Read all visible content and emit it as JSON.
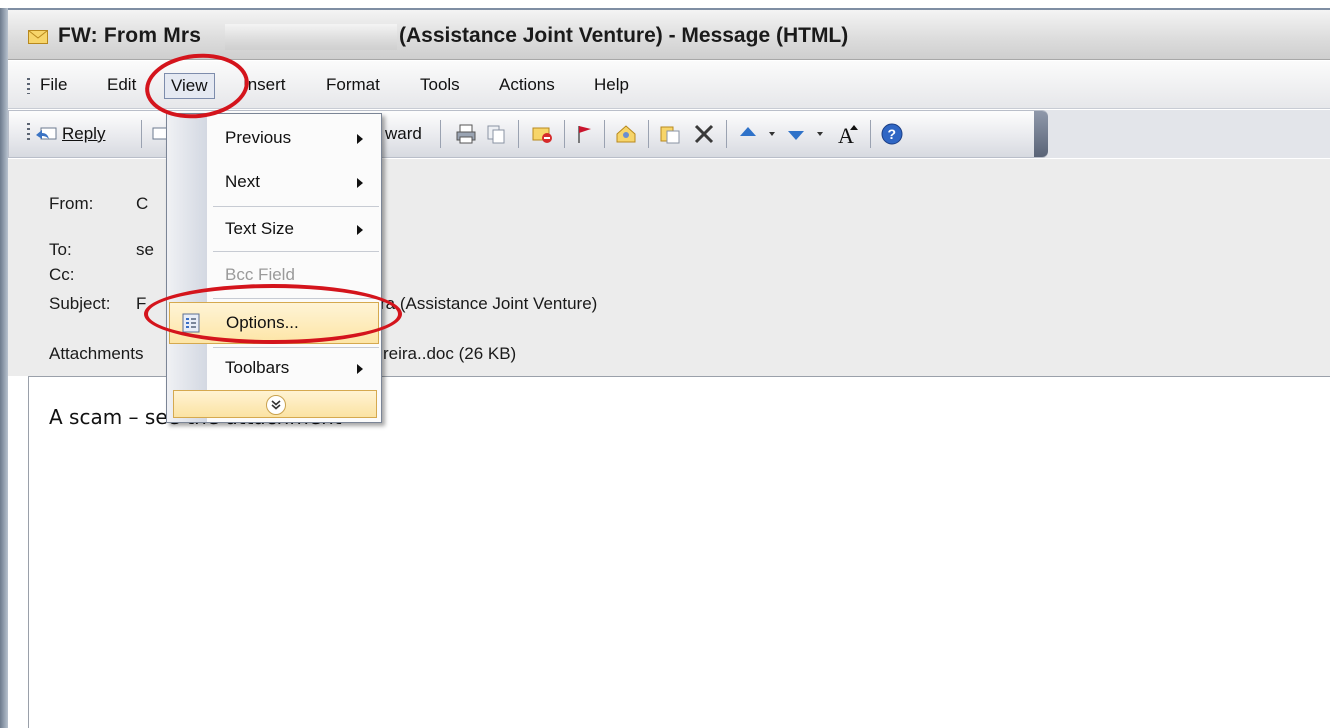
{
  "window": {
    "title_prefix": "FW: From Mrs",
    "title_suffix": "(Assistance Joint Venture) - Message (HTML)"
  },
  "menu": {
    "file": "File",
    "edit": "Edit",
    "view": "View",
    "insert": "Insert",
    "format": "Format",
    "tools": "Tools",
    "actions": "Actions",
    "help": "Help"
  },
  "toolbar": {
    "reply": "Reply",
    "forward_fragment": "ward"
  },
  "header": {
    "from_label": "From:",
    "from_value": "C",
    "to_label": "To:",
    "to_value": "se",
    "cc_label": "Cc:",
    "subject_label": "Subject:",
    "subject_value_start": "F",
    "subject_value_end": "ra (Assistance Joint Venture)",
    "attachments_label": "Attachments",
    "attachments_value": "reira..doc (26 KB)"
  },
  "body": {
    "text": "A scam – see the attachment"
  },
  "view_menu": {
    "items": [
      {
        "label": "Previous",
        "submenu": true,
        "enabled": true
      },
      {
        "label": "Next",
        "submenu": true,
        "enabled": true
      },
      {
        "label": "Text Size",
        "submenu": true,
        "enabled": true
      },
      {
        "label": "Bcc Field",
        "submenu": false,
        "enabled": false
      },
      {
        "label": "Options...",
        "submenu": false,
        "enabled": true,
        "highlighted": true
      },
      {
        "label": "Toolbars",
        "submenu": true,
        "enabled": true
      }
    ],
    "expand_icon": "chevron-double-down-icon"
  },
  "colors": {
    "annotation_red": "#d4141c",
    "highlight": "#fde5a6"
  }
}
